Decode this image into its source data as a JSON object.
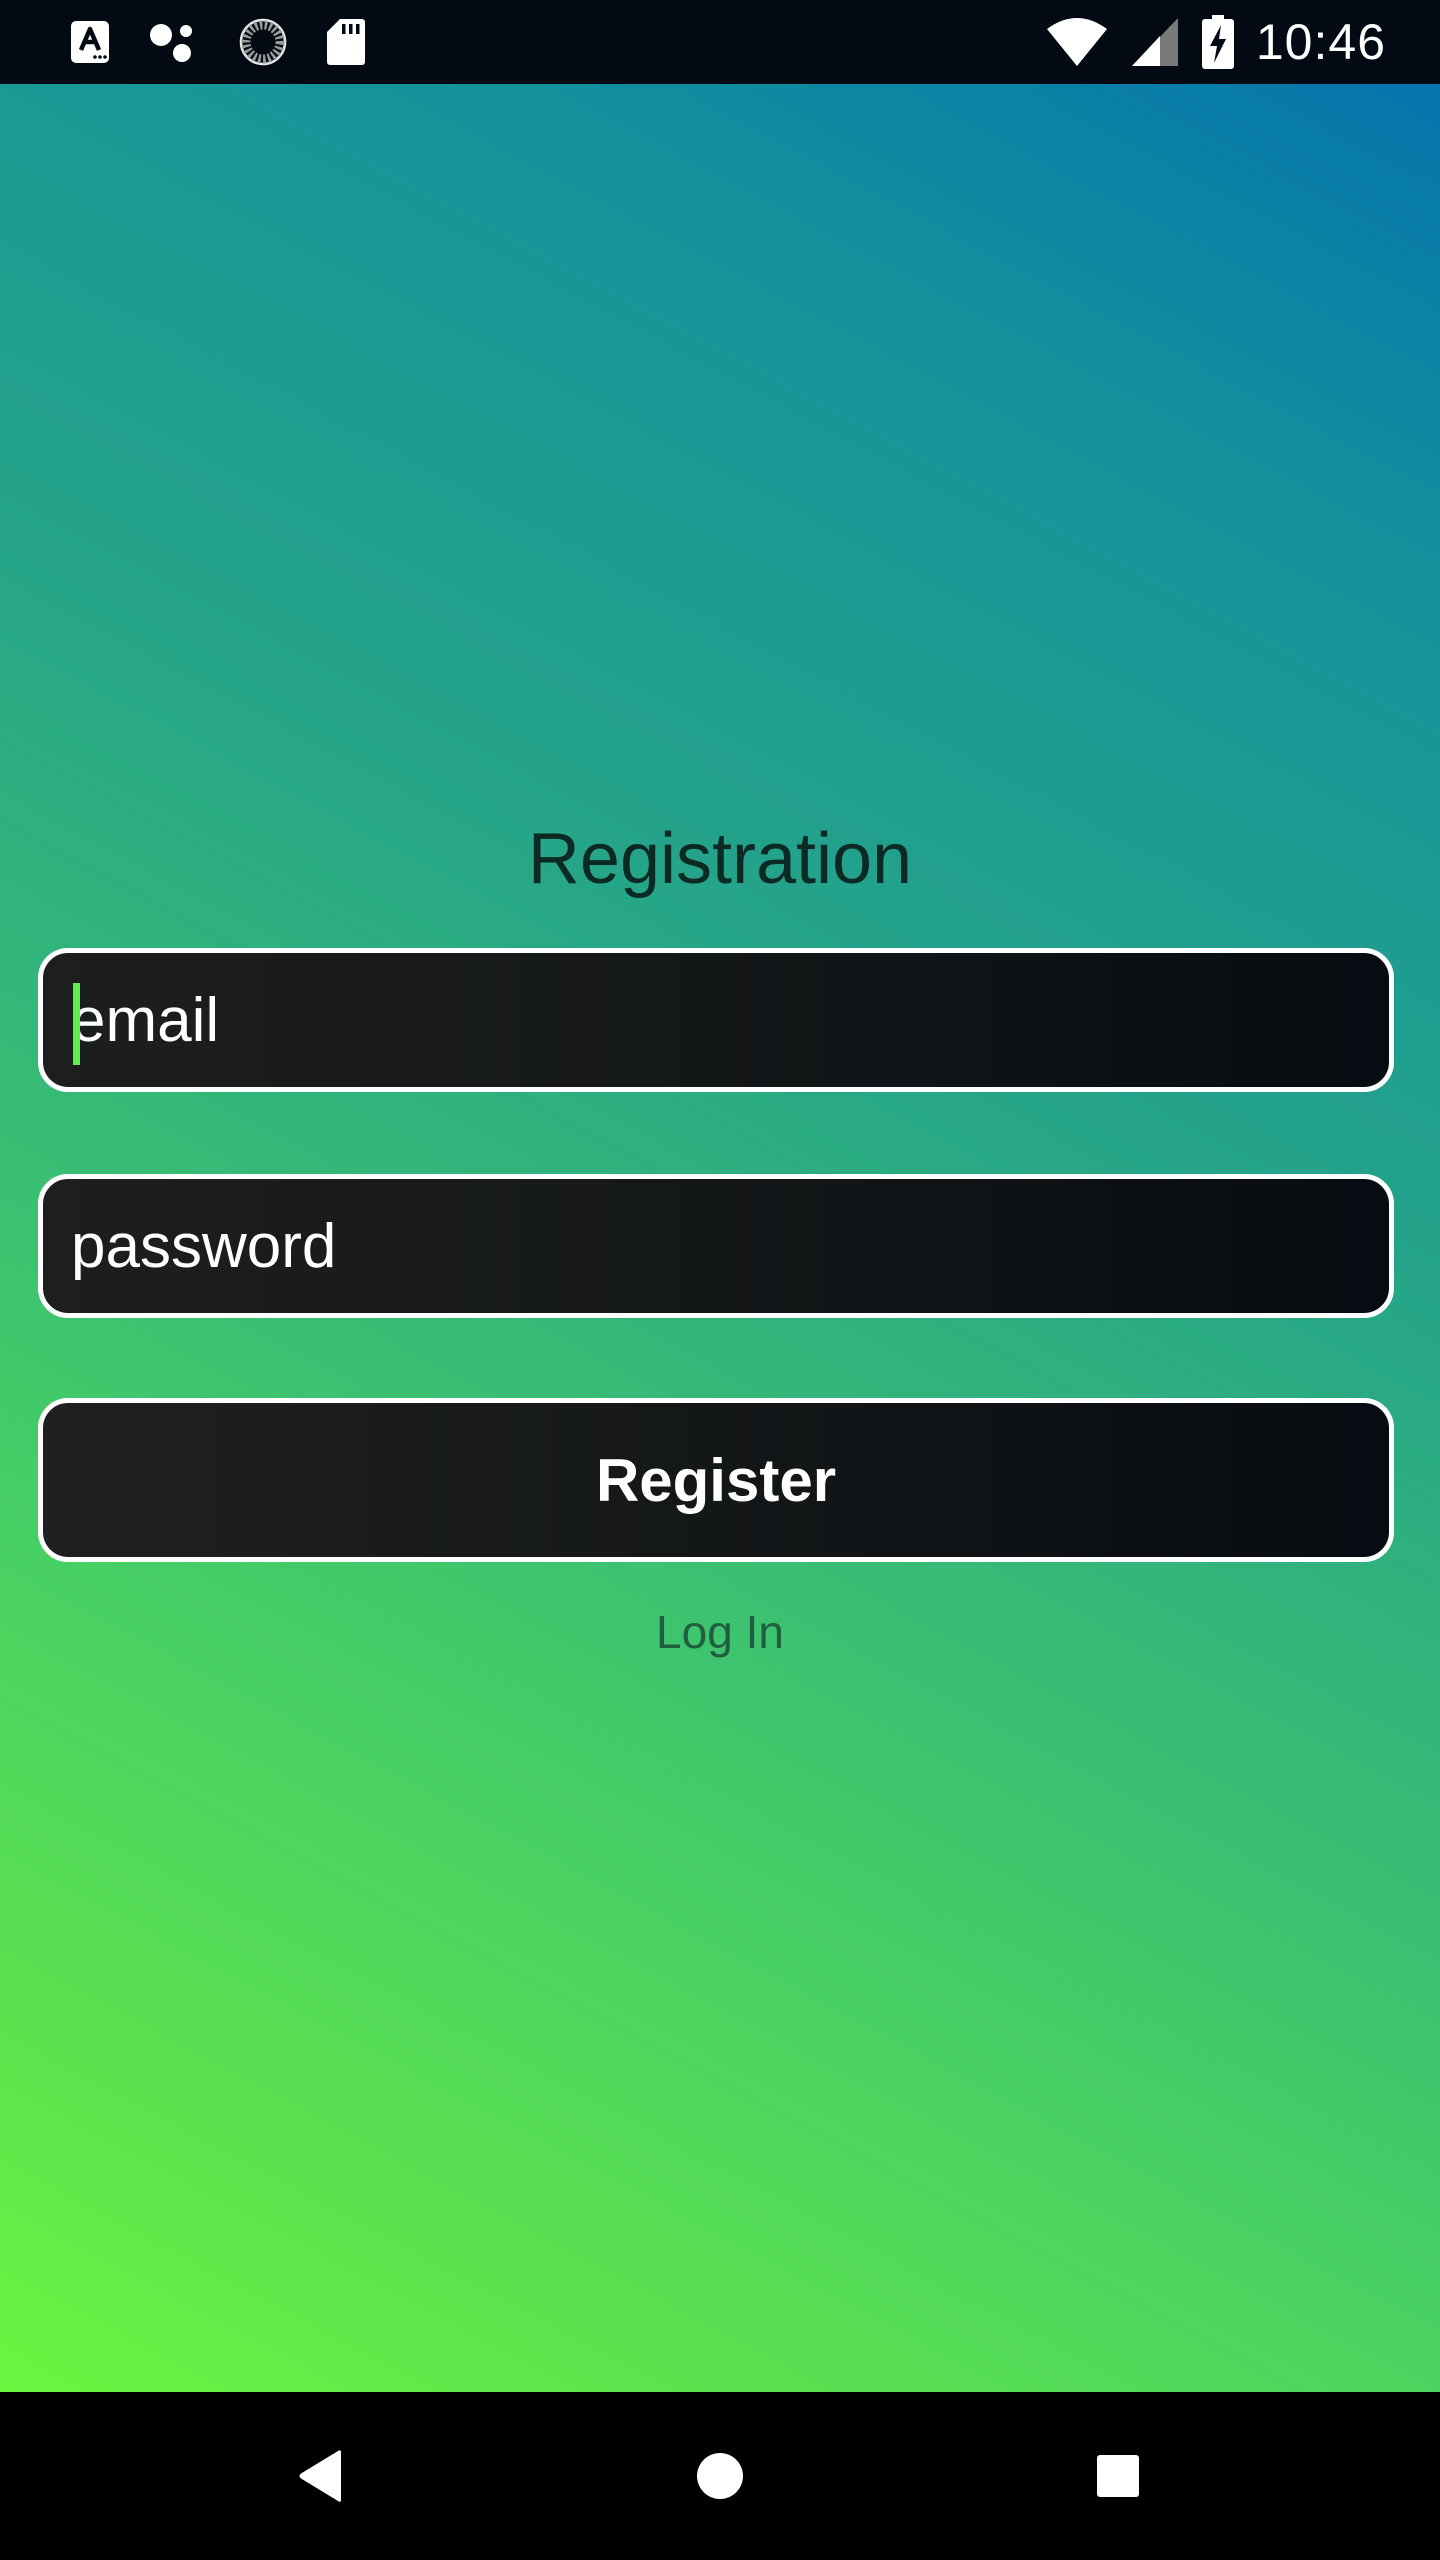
{
  "status_bar": {
    "time": "10:46",
    "left_icons": [
      "text-a-icon",
      "assistant-dots-icon",
      "sync-spinner-icon",
      "sd-card-icon"
    ],
    "right_icons": [
      "wifi-icon",
      "cell-signal-icon",
      "battery-charging-icon"
    ]
  },
  "form": {
    "title": "Registration",
    "email_placeholder": "email",
    "password_placeholder": "password",
    "register_label": "Register",
    "login_label": "Log In"
  },
  "colors": {
    "gradient_top_right": "#0475ad",
    "gradient_bottom_left": "#6cf541",
    "caret": "#5df24a",
    "field_border": "#ffffff",
    "title_text": "#0c2a24",
    "link_text": "#1f5e3e"
  },
  "nav_bar": {
    "icons": [
      "back-icon",
      "home-icon",
      "recents-icon"
    ]
  }
}
